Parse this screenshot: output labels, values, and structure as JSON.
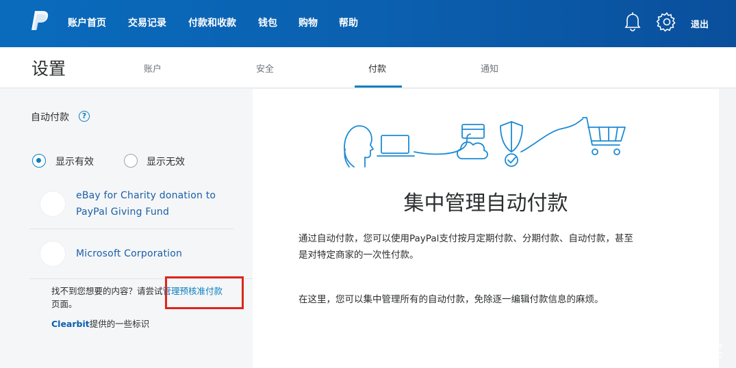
{
  "nav": {
    "items": [
      "账户首页",
      "交易记录",
      "付款和收款",
      "钱包",
      "购物",
      "帮助"
    ],
    "logout": "退出"
  },
  "settings": {
    "title": "设置",
    "tabs": [
      "账户",
      "安全",
      "付款",
      "通知"
    ],
    "active_tab": "付款"
  },
  "left": {
    "section_title": "自动付款",
    "help_symbol": "?",
    "radio_active": "显示有效",
    "radio_inactive": "显示无效",
    "merchants": [
      {
        "line1": "eBay for Charity donation to",
        "line2": "PayPal Giving Fund"
      },
      {
        "line1": "Microsoft Corporation",
        "line2": ""
      }
    ],
    "hint_prefix": "找不到您想要的内容？请尝试",
    "hint_link": "管理预核准付款",
    "hint_suffix": "页面。",
    "clearbit_link": "Clearbit",
    "clearbit_suffix": "提供的一些标识"
  },
  "right": {
    "title": "集中管理自动付款",
    "para1_line1": "通过自动付款，您可以使用PayPal支付按月定期付款、分期付款、自动付款，甚至",
    "para1_line2": "是对特定商家的一次性付款。",
    "para2": "在这里，您可以集中管理所有的自动付款，免除逐一编辑付款信息的麻烦。"
  },
  "watermark": "值 什么值得买",
  "colors": {
    "brand_blue": "#0a6bbd",
    "link_blue": "#0a7ec2",
    "highlight_red": "#e0241b"
  }
}
